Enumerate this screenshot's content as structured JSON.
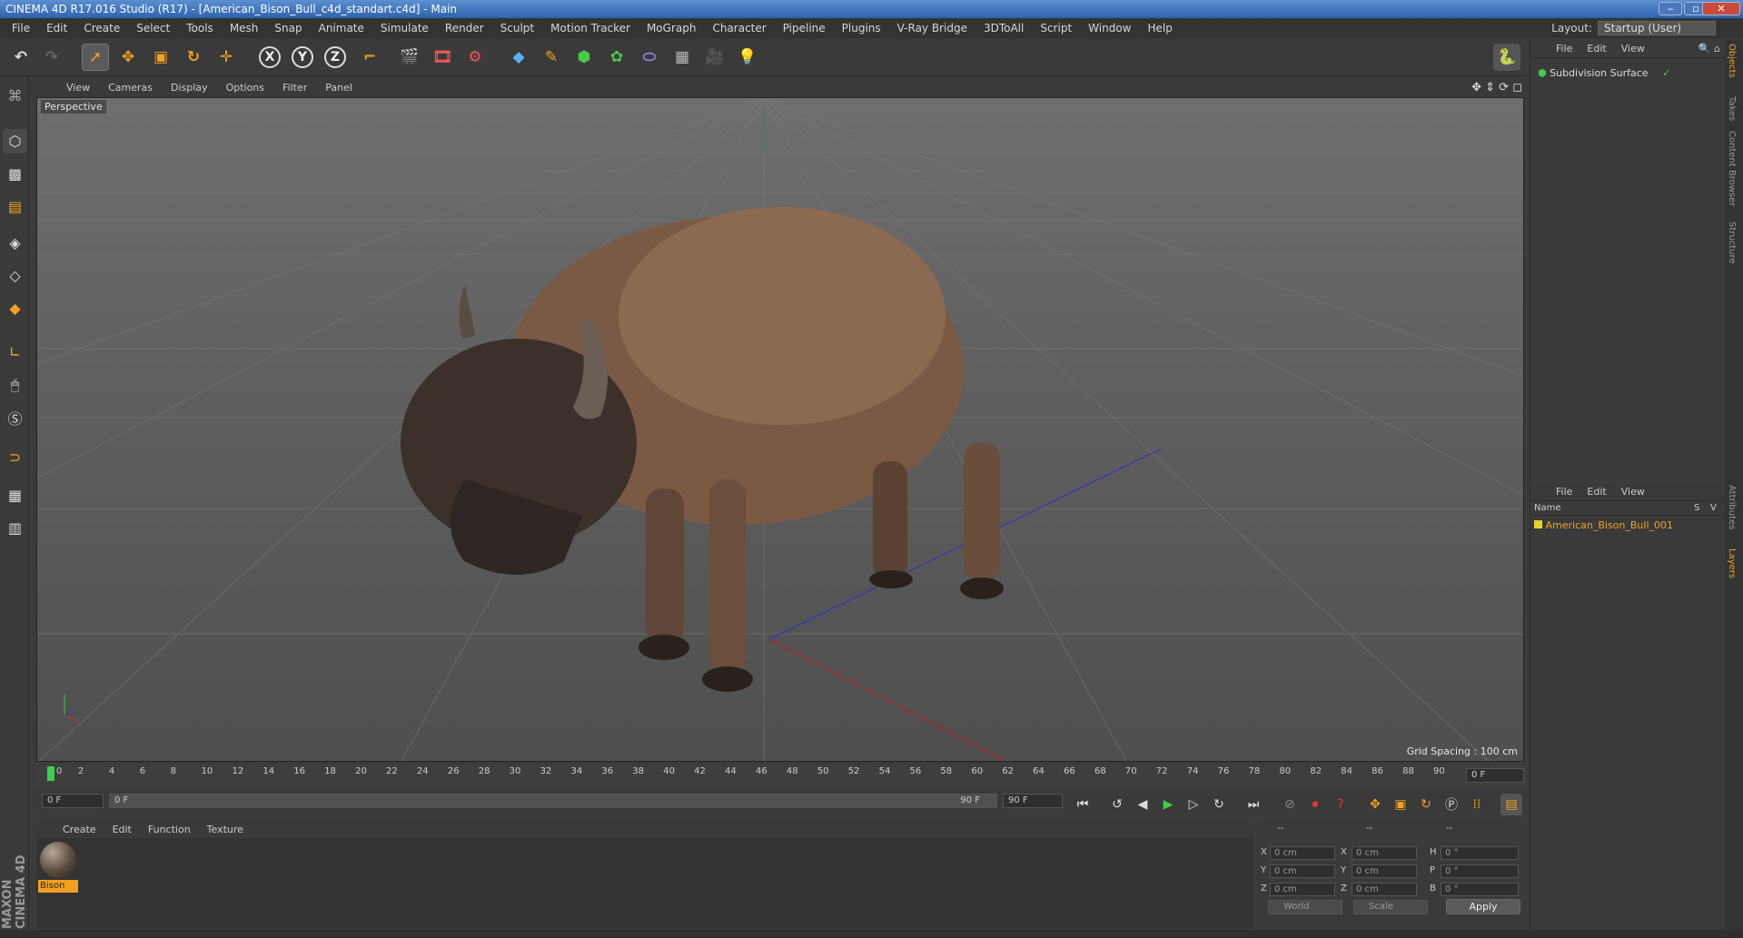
{
  "window": {
    "title": "CINEMA 4D R17.016 Studio (R17) - [American_Bison_Bull_c4d_standart.c4d] - Main",
    "minimize": "‒",
    "restore": "▫",
    "close": "✕"
  },
  "menubar": {
    "items": [
      "File",
      "Edit",
      "Create",
      "Select",
      "Tools",
      "Mesh",
      "Snap",
      "Animate",
      "Simulate",
      "Render",
      "Sculpt",
      "Motion Tracker",
      "MoGraph",
      "Character",
      "Pipeline",
      "Plugins",
      "V-Ray Bridge",
      "3DToAll",
      "Script",
      "Window",
      "Help"
    ],
    "layout_label": "Layout:",
    "layout_value": "Startup (User)"
  },
  "toolbar": {
    "axis_x": "X",
    "axis_y": "Y",
    "axis_z": "Z"
  },
  "viewport": {
    "menu": [
      "View",
      "Cameras",
      "Display",
      "Options",
      "Filter",
      "Panel"
    ],
    "camera_label": "Perspective",
    "grid_spacing": "Grid Spacing : 100 cm"
  },
  "timeline": {
    "ticks": [
      "0",
      "2",
      "4",
      "6",
      "8",
      "10",
      "12",
      "14",
      "16",
      "18",
      "20",
      "22",
      "24",
      "26",
      "28",
      "30",
      "32",
      "34",
      "36",
      "38",
      "40",
      "42",
      "44",
      "46",
      "48",
      "50",
      "52",
      "54",
      "56",
      "58",
      "60",
      "62",
      "64",
      "66",
      "68",
      "70",
      "72",
      "74",
      "76",
      "78",
      "80",
      "82",
      "84",
      "86",
      "88",
      "90"
    ],
    "current_frame": "0 F",
    "start_field": "0 F",
    "range_start": "0 F",
    "range_end": "90 F",
    "end_field": "90 F"
  },
  "materials": {
    "menu": [
      "Create",
      "Edit",
      "Function",
      "Texture"
    ],
    "items": [
      {
        "name": "Bison"
      }
    ]
  },
  "coords": {
    "header": [
      "--",
      "--",
      "--"
    ],
    "rows": [
      {
        "l1": "X",
        "v1": "0 cm",
        "l2": "X",
        "v2": "0 cm",
        "l3": "H",
        "v3": "0 °"
      },
      {
        "l1": "Y",
        "v1": "0 cm",
        "l2": "Y",
        "v2": "0 cm",
        "l3": "P",
        "v3": "0 °"
      },
      {
        "l1": "Z",
        "v1": "0 cm",
        "l2": "Z",
        "v2": "0 cm",
        "l3": "B",
        "v3": "0 °"
      }
    ],
    "mode1": "World",
    "mode2": "Scale",
    "apply": "Apply"
  },
  "objects": {
    "menu": [
      "File",
      "Edit",
      "View"
    ],
    "items": [
      {
        "name": "Subdivision Surface"
      }
    ]
  },
  "layers": {
    "menu": [
      "File",
      "Edit",
      "View"
    ],
    "col_name": "Name",
    "col_s": "S",
    "col_v": "V",
    "items": [
      {
        "name": "American_Bison_Bull_001"
      }
    ]
  },
  "sidetabs": [
    "Objects",
    "Takes",
    "Content Browser",
    "Structure",
    "Attributes",
    "Layers"
  ],
  "branding": "MAXON CINEMA 4D",
  "colors": {
    "accent": "#f2a11e",
    "background": "#3b3b3b",
    "viewport_top": "#6e6e6e",
    "titlebar": "#2e63ad"
  }
}
